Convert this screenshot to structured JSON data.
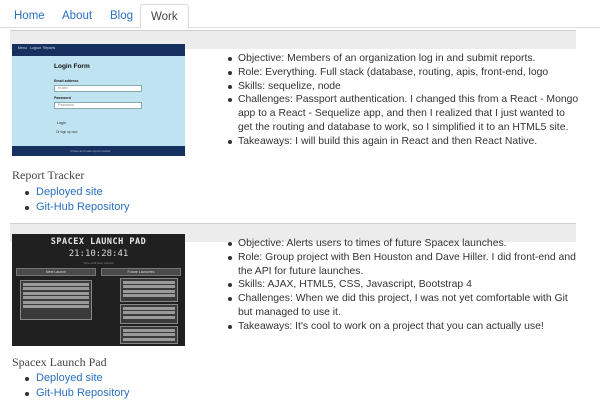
{
  "nav": {
    "tabs": [
      {
        "label": "Home",
        "active": false
      },
      {
        "label": "About",
        "active": false
      },
      {
        "label": "Blog",
        "active": false
      },
      {
        "label": "Work",
        "active": true
      }
    ]
  },
  "colors": {
    "link": "#2a6fbf",
    "strip": "#ececec"
  },
  "projects": [
    {
      "title": "Report Tracker",
      "thumbnail": {
        "nav_items": [
          "Menu",
          "Logout",
          "Reports"
        ],
        "form_title": "Login Form",
        "email_label": "Email address",
        "email_value": "m.abc",
        "password_label": "Password",
        "password_value": "Password",
        "button_label": "Login",
        "signup_text": "Or sign up now",
        "footer_text": "Chase and Lake report tracker"
      },
      "links": [
        {
          "label": "Deployed site"
        },
        {
          "label": "Git-Hub Repository"
        }
      ],
      "details": [
        "Objective: Members of an organization log in and submit reports.",
        "Role: Everything. Full stack (database, routing, apis, front-end, logo",
        "Skills: sequelize, node",
        "Challenges: Passport authentication. I changed this from a React - Mongo app to a React - Sequelize app, and then I realized that I just wanted to get the routing and database to work, so I simplified it to an HTML5 site.",
        "Takeaways: I will build this again in React and then React Native."
      ]
    },
    {
      "title": "Spacex Launch Pad",
      "thumbnail": {
        "title": "SPACEX LAUNCH PAD",
        "clock": "21:10:28:41",
        "subtitle": "Time until Next Launch",
        "left_heading": "Next Launch",
        "right_heading": "Future Launches"
      },
      "links": [
        {
          "label": "Deployed site"
        },
        {
          "label": "Git-Hub Repository"
        }
      ],
      "details": [
        "Objective: Alerts users to times of future Spacex launches.",
        "Role: Group project with Ben Houston and Dave Hiller. I did front-end and the API for future launches.",
        "Skills: AJAX, HTML5, CSS, Javascript, Bootstrap 4",
        "Challenges: When we did this project, I was not yet comfortable with Git but managed to use it.",
        "Takeaways: It's cool to work on a project that you can actually use!"
      ]
    }
  ]
}
